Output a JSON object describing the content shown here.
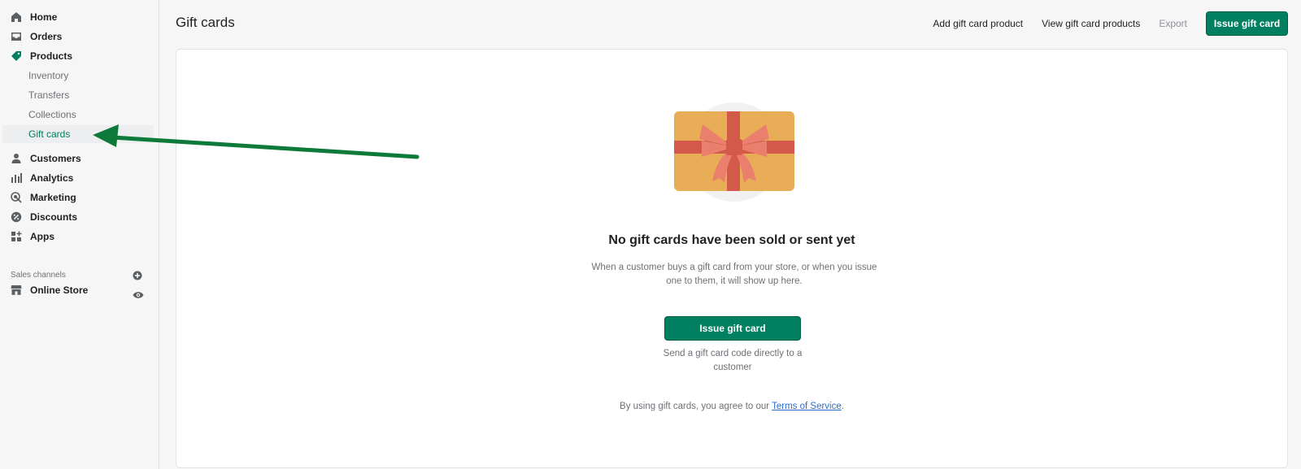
{
  "sidebar": {
    "items": [
      {
        "label": "Home",
        "icon": "home-icon"
      },
      {
        "label": "Orders",
        "icon": "inbox-icon"
      },
      {
        "label": "Products",
        "icon": "tag-icon"
      }
    ],
    "products_sub": [
      {
        "label": "Inventory"
      },
      {
        "label": "Transfers"
      },
      {
        "label": "Collections"
      },
      {
        "label": "Gift cards",
        "active": true
      }
    ],
    "items_after": [
      {
        "label": "Customers",
        "icon": "person-icon"
      },
      {
        "label": "Analytics",
        "icon": "bar-chart-icon"
      },
      {
        "label": "Marketing",
        "icon": "target-icon"
      },
      {
        "label": "Discounts",
        "icon": "discount-icon"
      },
      {
        "label": "Apps",
        "icon": "apps-icon"
      }
    ],
    "sales_channels_label": "Sales channels",
    "online_store": {
      "label": "Online Store",
      "icon": "store-icon"
    }
  },
  "header": {
    "title": "Gift cards",
    "add_product": "Add gift card product",
    "view_products": "View gift card products",
    "export": "Export",
    "issue": "Issue gift card"
  },
  "empty_state": {
    "title": "No gift cards have been sold or sent yet",
    "description": "When a customer buys a gift card from your store, or when you issue one to them, it will show up here.",
    "button": "Issue gift card",
    "button_help": "Send a gift card code directly to a customer",
    "legal_prefix": "By using gift cards, you agree to our ",
    "legal_link": "Terms of Service",
    "legal_suffix": "."
  },
  "colors": {
    "accent": "#008060",
    "arrow": "#0d7a3a",
    "gift_card": "#e8ad56",
    "ribbon": "#d35a4a"
  }
}
